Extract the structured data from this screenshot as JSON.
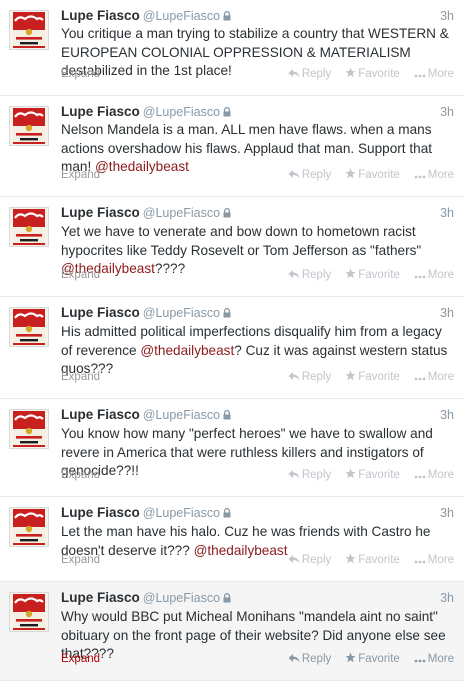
{
  "tweets": [
    {
      "name": "Lupe Fiasco",
      "handle": "@LupeFiasco",
      "time": "3h",
      "text": [
        {
          "t": "You critique a man trying to stabilize a country that WESTERN & EUROPEAN COLONIAL OPPRESSION & MATERIALISM destabilized in the 1st place!"
        }
      ],
      "expand": "Expand",
      "reply": "Reply",
      "favorite": "Favorite",
      "more": "More"
    },
    {
      "name": "Lupe Fiasco",
      "handle": "@LupeFiasco",
      "time": "3h",
      "text": [
        {
          "t": "Nelson Mandela is a man. ALL men have flaws. when a mans actions overshadow his flaws. Applaud that man. Support that man! "
        },
        {
          "m": "@thedailybeast"
        }
      ],
      "expand": "Expand",
      "reply": "Reply",
      "favorite": "Favorite",
      "more": "More"
    },
    {
      "name": "Lupe Fiasco",
      "handle": "@LupeFiasco",
      "time": "3h",
      "text": [
        {
          "t": "Yet we have to venerate and bow down to hometown racist hypocrites like Teddy Rosevelt or Tom Jefferson as \"fathers\" "
        },
        {
          "m": "@thedailybeast"
        },
        {
          "t": "????"
        }
      ],
      "expand": "Expand",
      "reply": "Reply",
      "favorite": "Favorite",
      "more": "More"
    },
    {
      "name": "Lupe Fiasco",
      "handle": "@LupeFiasco",
      "time": "3h",
      "text": [
        {
          "t": "His admitted political imperfections disqualify him from a legacy of reverence "
        },
        {
          "m": "@thedailybeast"
        },
        {
          "t": "? Cuz it was against western status quos???"
        }
      ],
      "expand": "Expand",
      "reply": "Reply",
      "favorite": "Favorite",
      "more": "More"
    },
    {
      "name": "Lupe Fiasco",
      "handle": "@LupeFiasco",
      "time": "3h",
      "text": [
        {
          "t": "You know how many \"perfect heroes\" we have to swallow and revere in America that were ruthless killers and instigators of genocide??!!"
        }
      ],
      "expand": "Expand",
      "reply": "Reply",
      "favorite": "Favorite",
      "more": "More"
    },
    {
      "name": "Lupe Fiasco",
      "handle": "@LupeFiasco",
      "time": "3h",
      "text": [
        {
          "t": "Let the man have his halo. Cuz he was friends with Castro he doesn't deserve it??? "
        },
        {
          "m": "@thedailybeast"
        }
      ],
      "expand": "Expand",
      "reply": "Reply",
      "favorite": "Favorite",
      "more": "More"
    },
    {
      "name": "Lupe Fiasco",
      "handle": "@LupeFiasco",
      "time": "3h",
      "text": [
        {
          "t": "Why would BBC put Micheal Monihans \"mandela aint no saint\" obituary on the front page of their website? Did anyone else see that????"
        }
      ],
      "expand": "Expand",
      "reply": "Reply",
      "favorite": "Favorite",
      "more": "More"
    }
  ],
  "icons": {
    "avatar": "campbells-soup-can-icon",
    "protected": "lock-icon",
    "reply": "reply-arrow-icon",
    "favorite": "star-icon",
    "more": "ellipsis-icon"
  },
  "colors": {
    "name": "#292f33",
    "meta": "#8899a6",
    "mention": "#8b1a1a",
    "expand_active": "#b10000",
    "hover_background": "#f5f5f5"
  },
  "hovered_index": 6
}
